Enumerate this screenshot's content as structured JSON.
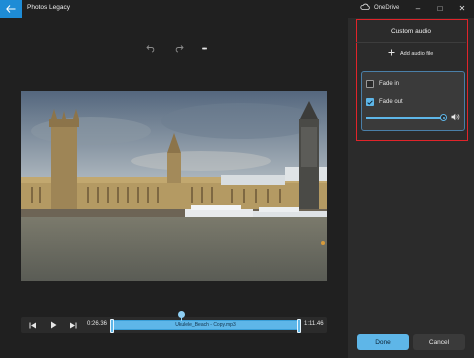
{
  "titlebar": {
    "app_title": "Photos Legacy",
    "onedrive_label": "OneDrive",
    "minimize_glyph": "–",
    "maximize_glyph": "□",
    "close_glyph": "✕"
  },
  "toolbar": {
    "undo_icon": "undo-icon",
    "redo_icon": "redo-icon",
    "more_glyph": "•••"
  },
  "playback": {
    "current_time": "0:26.36",
    "total_time": "1:11.46",
    "track_label": "Ukulele_Beach - Copy.mp3",
    "progress_fraction": 0.37
  },
  "panel": {
    "title": "Custom audio",
    "add_audio_label": "Add audio file",
    "options": [
      {
        "label": "Fade in",
        "checked": false
      },
      {
        "label": "Fade out",
        "checked": true
      }
    ],
    "volume_fraction": 1.0,
    "done_label": "Done",
    "cancel_label": "Cancel"
  },
  "colors": {
    "accent": "#5eb6e8",
    "highlight_frame": "#e0242a",
    "back_button": "#1e8cd6"
  }
}
